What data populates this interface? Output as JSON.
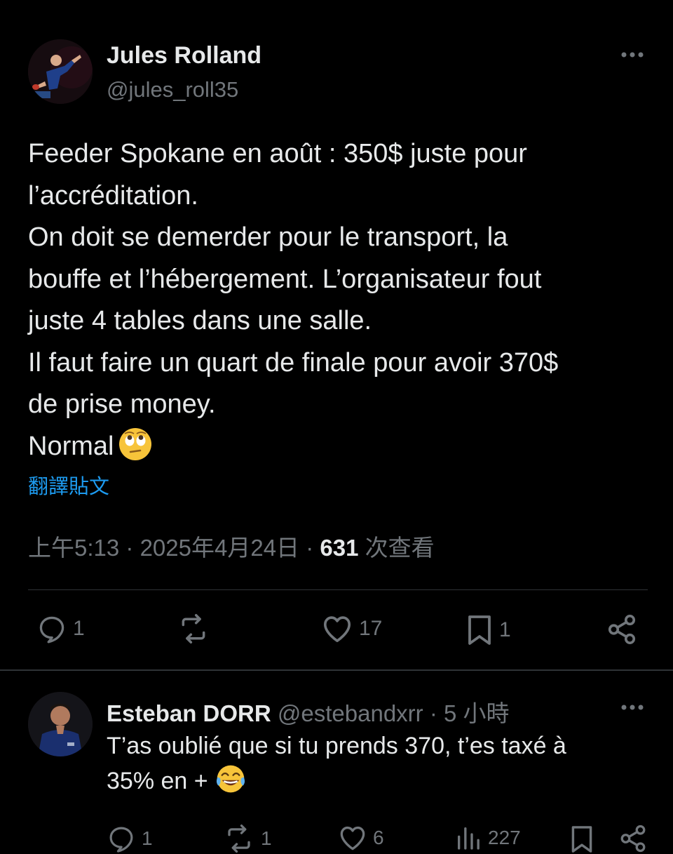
{
  "post": {
    "author_name": "Jules Rolland",
    "author_handle": "@jules_roll35",
    "text_lines": [
      "Feeder Spokane en août : 350$ juste pour",
      "l’accréditation.",
      "On doit se demerder pour le transport, la",
      "bouffe et l’hébergement. L’organisateur fout",
      "juste 4 tables dans une salle.",
      "Il faut faire un quart de finale pour avoir 370$",
      "de prise money.",
      "Normal"
    ],
    "emoji": "eye-roll-emoji",
    "translate_label": "翻譯貼文",
    "time": "上午5:13",
    "date": "2025年4月24日",
    "separator": "·",
    "views": "631",
    "views_label": "次查看",
    "actions": {
      "replies": "1",
      "reposts": "",
      "likes": "17",
      "bookmarks": "1"
    }
  },
  "reply": {
    "author_name": "Esteban DORR",
    "author_handle": "@estebandxrr",
    "separator": "·",
    "time": "5 小時",
    "text_lines": [
      "T’as oublié que si tu prends 370, t’es taxé à",
      "35% en +"
    ],
    "emoji": "laughing-tears-emoji",
    "actions": {
      "replies": "1",
      "reposts": "1",
      "likes": "6",
      "views": "227"
    }
  },
  "colors": {
    "background": "#000000",
    "text_primary": "#e7e9ea",
    "text_secondary": "#71767b",
    "link": "#1d9bf0",
    "divider": "#2f3336"
  }
}
